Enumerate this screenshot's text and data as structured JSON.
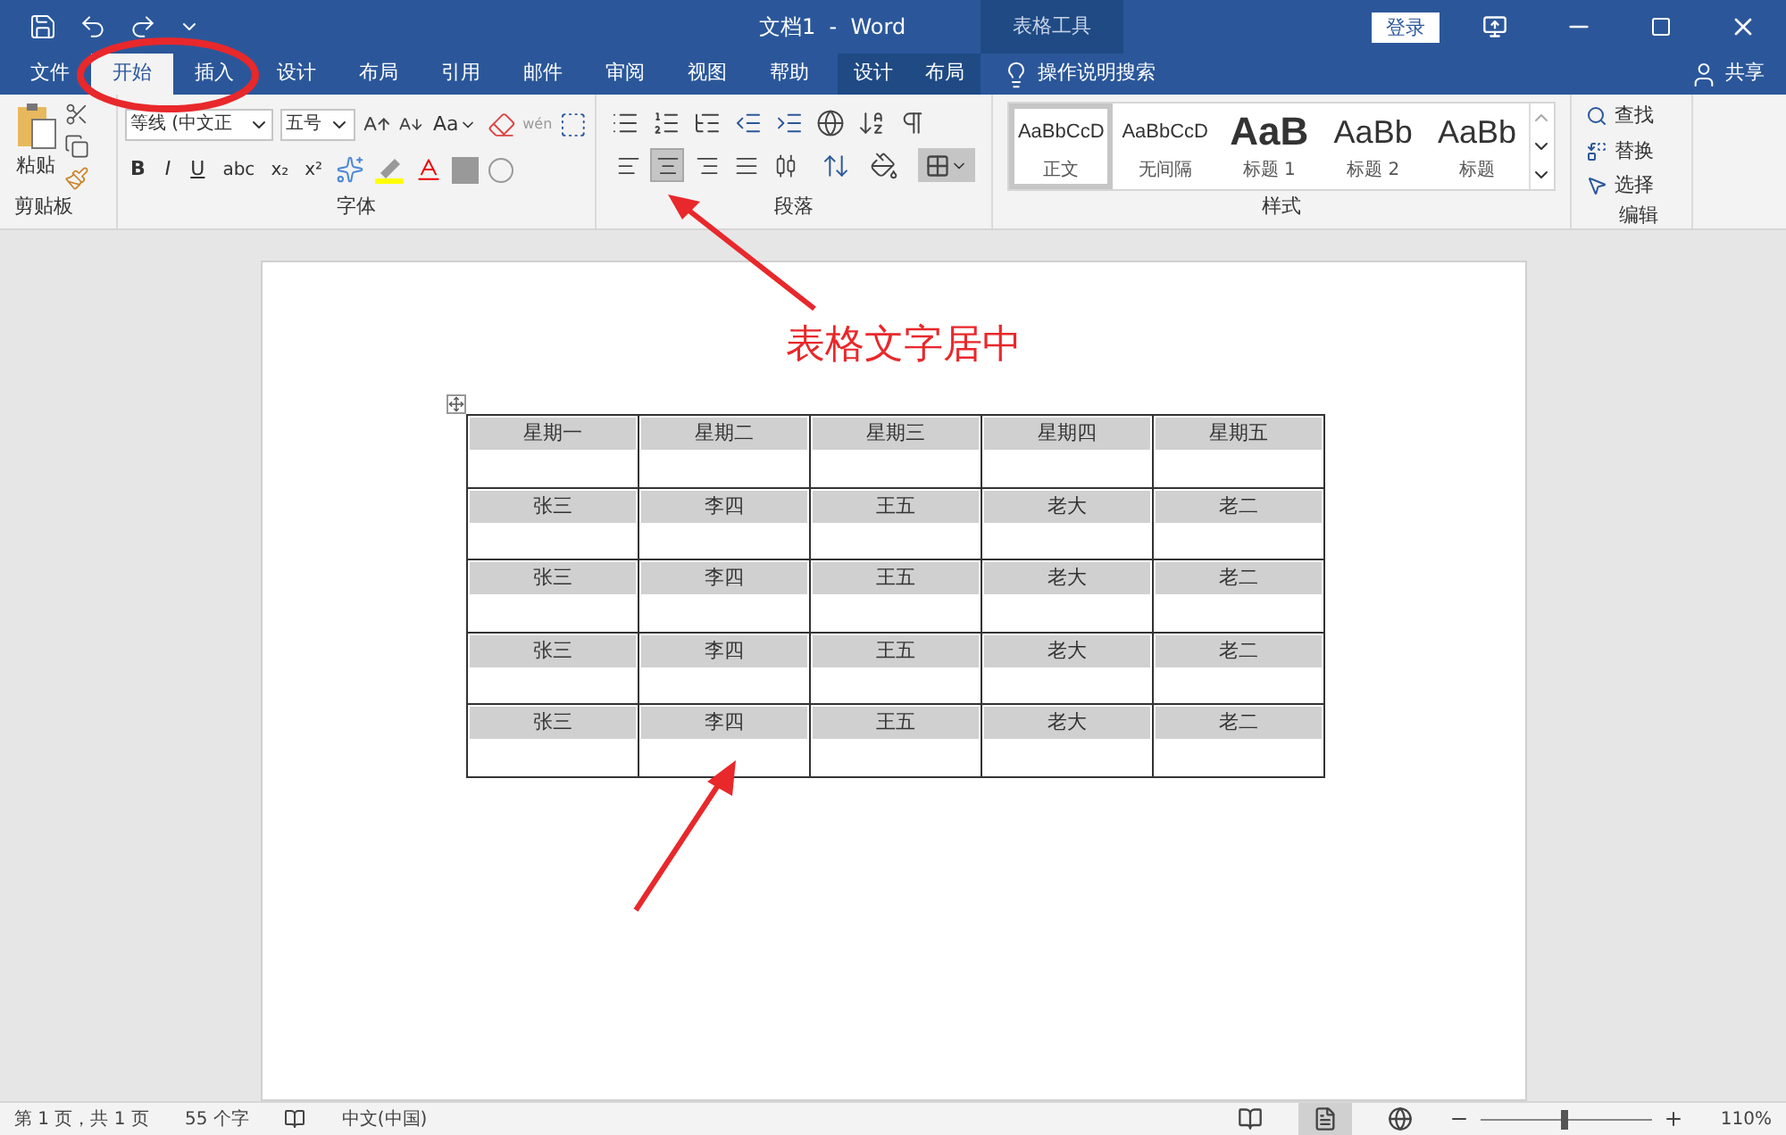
{
  "window": {
    "title": "文档1  -  Word",
    "context_tab_group": "表格工具",
    "login": "登录"
  },
  "tabs": [
    {
      "label": "文件",
      "selected": false
    },
    {
      "label": "开始",
      "selected": true
    },
    {
      "label": "插入",
      "selected": false
    },
    {
      "label": "设计",
      "selected": false
    },
    {
      "label": "布局",
      "selected": false
    },
    {
      "label": "引用",
      "selected": false
    },
    {
      "label": "邮件",
      "selected": false
    },
    {
      "label": "审阅",
      "selected": false
    },
    {
      "label": "视图",
      "selected": false
    },
    {
      "label": "帮助",
      "selected": false
    }
  ],
  "context_tabs": [
    {
      "label": "设计",
      "selected": false
    },
    {
      "label": "布局",
      "selected": false
    }
  ],
  "tell_me": "操作说明搜索",
  "share": "共享",
  "ribbon": {
    "clipboard": {
      "paste": "粘贴",
      "label": "剪贴板"
    },
    "font": {
      "name": "等线 (中文正",
      "size": "五号",
      "case": "Aa",
      "format_buttons": [
        "B",
        "I",
        "U",
        "abc",
        "x₂",
        "x²"
      ],
      "phonetic": "wén",
      "label": "字体"
    },
    "paragraph": {
      "alignments": [
        {
          "kind": "left",
          "selected": false
        },
        {
          "kind": "center",
          "selected": true
        },
        {
          "kind": "right",
          "selected": false
        },
        {
          "kind": "justify",
          "selected": false
        },
        {
          "kind": "distributed",
          "selected": false
        }
      ],
      "label": "段落"
    },
    "styles": {
      "items": [
        {
          "preview": "AaBbCcD",
          "name": "正文",
          "kind": "normal",
          "selected": true
        },
        {
          "preview": "AaBbCcD",
          "name": "无间隔",
          "kind": "normal",
          "selected": false
        },
        {
          "preview": "AaB",
          "name": "标题 1",
          "kind": "h1",
          "selected": false
        },
        {
          "preview": "AaBb",
          "name": "标题 2",
          "kind": "h2",
          "selected": false
        },
        {
          "preview": "AaBb",
          "name": "标题",
          "kind": "title",
          "selected": false
        }
      ],
      "label": "样式"
    },
    "editing": {
      "items": [
        "查找",
        "替换",
        "选择"
      ],
      "label": "编辑"
    }
  },
  "table": {
    "rows": [
      [
        "星期一",
        "星期二",
        "星期三",
        "星期四",
        "星期五"
      ],
      [
        "张三",
        "李四",
        "王五",
        "老大",
        "老二"
      ],
      [
        "张三",
        "李四",
        "王五",
        "老大",
        "老二"
      ],
      [
        "张三",
        "李四",
        "王五",
        "老大",
        "老二"
      ],
      [
        "张三",
        "李四",
        "王五",
        "老大",
        "老二"
      ]
    ]
  },
  "annotation": "表格文字居中",
  "status_bar": {
    "page": "第 1 页，共 1 页",
    "words": "55 个字",
    "language": "中文(中国)",
    "zoom": "110%",
    "zoom_slider": {
      "level": 0.49
    }
  }
}
